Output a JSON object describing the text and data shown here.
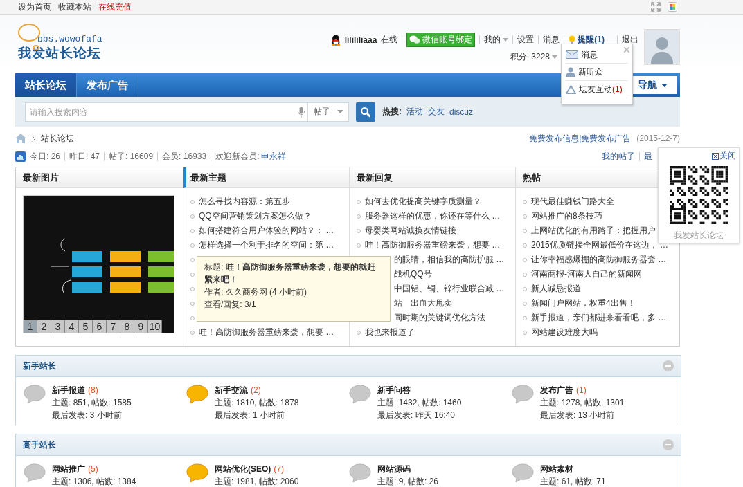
{
  "top_links": [
    {
      "label": "设为首页",
      "highlighted": false
    },
    {
      "label": "收藏本站",
      "highlighted": false
    },
    {
      "label": "在线充值",
      "highlighted": true
    }
  ],
  "logo": {
    "domain": "bbs.wowofafa",
    "name": "我发站长论坛"
  },
  "user": {
    "name": "lilililiaaa",
    "status": "在线",
    "wechat": "微信账号绑定",
    "links": [
      "我的",
      "设置",
      "消息"
    ],
    "remind": "提醒(1)",
    "logout": "退出",
    "points": "积分: 3228"
  },
  "notify_menu": [
    {
      "kind": "mail",
      "label": "消息"
    },
    {
      "kind": "person",
      "label": "新听众"
    },
    {
      "kind": "interact",
      "label": "坛友互动",
      "count": "(1)"
    }
  ],
  "nav": {
    "tabs": [
      {
        "label": "站长论坛",
        "selected": true
      },
      {
        "label": "发布广告",
        "selected": false
      }
    ],
    "quick": "导航"
  },
  "search": {
    "placeholder": "请输入搜索内容",
    "type": "帖子",
    "hot_label": "热搜:",
    "hot": [
      "活动",
      "交友",
      "discuz"
    ]
  },
  "breadcrumb": {
    "current": "站长论坛",
    "links": "免费发布信息|免费发布广告",
    "date": "(2015-12-7)"
  },
  "stats": {
    "items": [
      "今日: 26",
      "昨日: 47",
      "帖子: 16609",
      "会员: 16933"
    ],
    "welcome": "欢迎新会员:",
    "new_member": "申永祥",
    "links": [
      "我的帖子",
      "最"
    ]
  },
  "portal": {
    "columns": [
      {
        "title": "最新图片",
        "selected": false
      },
      {
        "title": "最新主题",
        "selected": true
      },
      {
        "title": "最新回复",
        "selected": false
      },
      {
        "title": "热帖",
        "selected": false
      }
    ],
    "slides": [
      {
        "label": "1",
        "selected": true
      },
      {
        "label": "2",
        "selected": false
      },
      {
        "label": "3",
        "selected": false
      },
      {
        "label": "4",
        "selected": false
      },
      {
        "label": "5",
        "selected": false
      },
      {
        "label": "6",
        "selected": false
      },
      {
        "label": "7",
        "selected": false
      },
      {
        "label": "8",
        "selected": false
      },
      {
        "label": "9",
        "selected": false
      },
      {
        "label": "10",
        "selected": false
      }
    ],
    "topics": [
      {
        "kind": "normal",
        "text": "怎么寻找内容源：第五步",
        "hovered": false
      },
      {
        "kind": "normal",
        "text": "QQ空间营销策划方案怎么做？",
        "hovered": false
      },
      {
        "kind": "normal",
        "text": "如何搭建符合用户体验的网站？： …",
        "hovered": false
      },
      {
        "kind": "normal",
        "text": "怎样选择一个利于排名的空间：第 …",
        "hovered": false
      },
      {
        "kind": "covered"
      },
      {
        "kind": "covered"
      },
      {
        "kind": "covered"
      },
      {
        "kind": "covered"
      },
      {
        "kind": "covered"
      },
      {
        "kind": "normal",
        "text": "哇！高防御服务器重磅来袭，想要 …",
        "hovered": true
      }
    ],
    "replies": [
      {
        "kind": "normal",
        "text": "如何去优化提高关键字质测量？"
      },
      {
        "kind": "normal",
        "text": "服务器这样的优惠，你还在等什么 …"
      },
      {
        "kind": "normal",
        "text": "母婴类网站诚换友情链接"
      },
      {
        "kind": "normal",
        "text": "哇！高防御服务器重磅来袭，想要 …"
      },
      {
        "kind": "partial",
        "text": "的眼睛，相信我的高防护服 …"
      },
      {
        "kind": "partial",
        "text": "战机QQ号"
      },
      {
        "kind": "partial",
        "text": "中国铝、铜、锌行业联合减 …"
      },
      {
        "kind": "partial",
        "text": "站　出血大甩卖"
      },
      {
        "kind": "partial",
        "text": "同时期的关键词优化方法"
      },
      {
        "kind": "normal",
        "text": "我也来报道了"
      }
    ],
    "hot": [
      "现代最佳赚钱门路大全",
      "网站推广的8条技巧",
      "上网站优化的有用路子：把握用户",
      "2015优质链接全网最低价在这边， …",
      "让你幸福感爆棚的高防御服务器套 …",
      "河南商报-河南人自己的新闻网",
      "新人诚恳报道",
      "新闻门户网站，权重4出售！",
      "新手报道，亲们都进来看看吧，多 …",
      "网站建设难度大吗"
    ]
  },
  "tooltip": {
    "title_label": "标题:",
    "title": "哇！高防御服务器重磅来袭，想要的就赶紧来吧！",
    "author": "作者: 久久商务网 (4 小时前)",
    "views": "查看/回复: 3/1"
  },
  "qr_panel": {
    "close": "关闭",
    "caption": "我发站长论坛"
  },
  "sections": [
    {
      "title": "新手站长",
      "forums": [
        {
          "name": "新手报道",
          "count": "(8)",
          "has_new": false,
          "stats": "主题: 851, 帖数: 1585",
          "last": "最后发表: 3 小时前"
        },
        {
          "name": "新手交流",
          "count": "(2)",
          "has_new": true,
          "stats": "主题: 1810, 帖数: 1878",
          "last": "最后发表: 1 小时前"
        },
        {
          "name": "新手问答",
          "has_new": false,
          "stats": "主题: 1432, 帖数: 1460",
          "last": "最后发表: 昨天 16:40"
        },
        {
          "name": "发布广告",
          "count": "(1)",
          "has_new": false,
          "stats": "主题: 1278, 帖数: 1301",
          "last": "最后发表: 13 小时前"
        }
      ]
    },
    {
      "title": "高手站长",
      "forums": [
        {
          "name": "网站推广",
          "count": "(5)",
          "has_new": false,
          "stats": "主题: 1306, 帖数: 1384"
        },
        {
          "name": "网站优化(SEO)",
          "count": "(7)",
          "has_new": true,
          "stats": "主题: 1981, 帖数: 2060"
        },
        {
          "name": "网站源码",
          "has_new": false,
          "stats": "主题: 9, 帖数: 26"
        },
        {
          "name": "网站素材",
          "has_new": false,
          "stats": "主题: 61, 帖数: 71"
        }
      ]
    }
  ]
}
